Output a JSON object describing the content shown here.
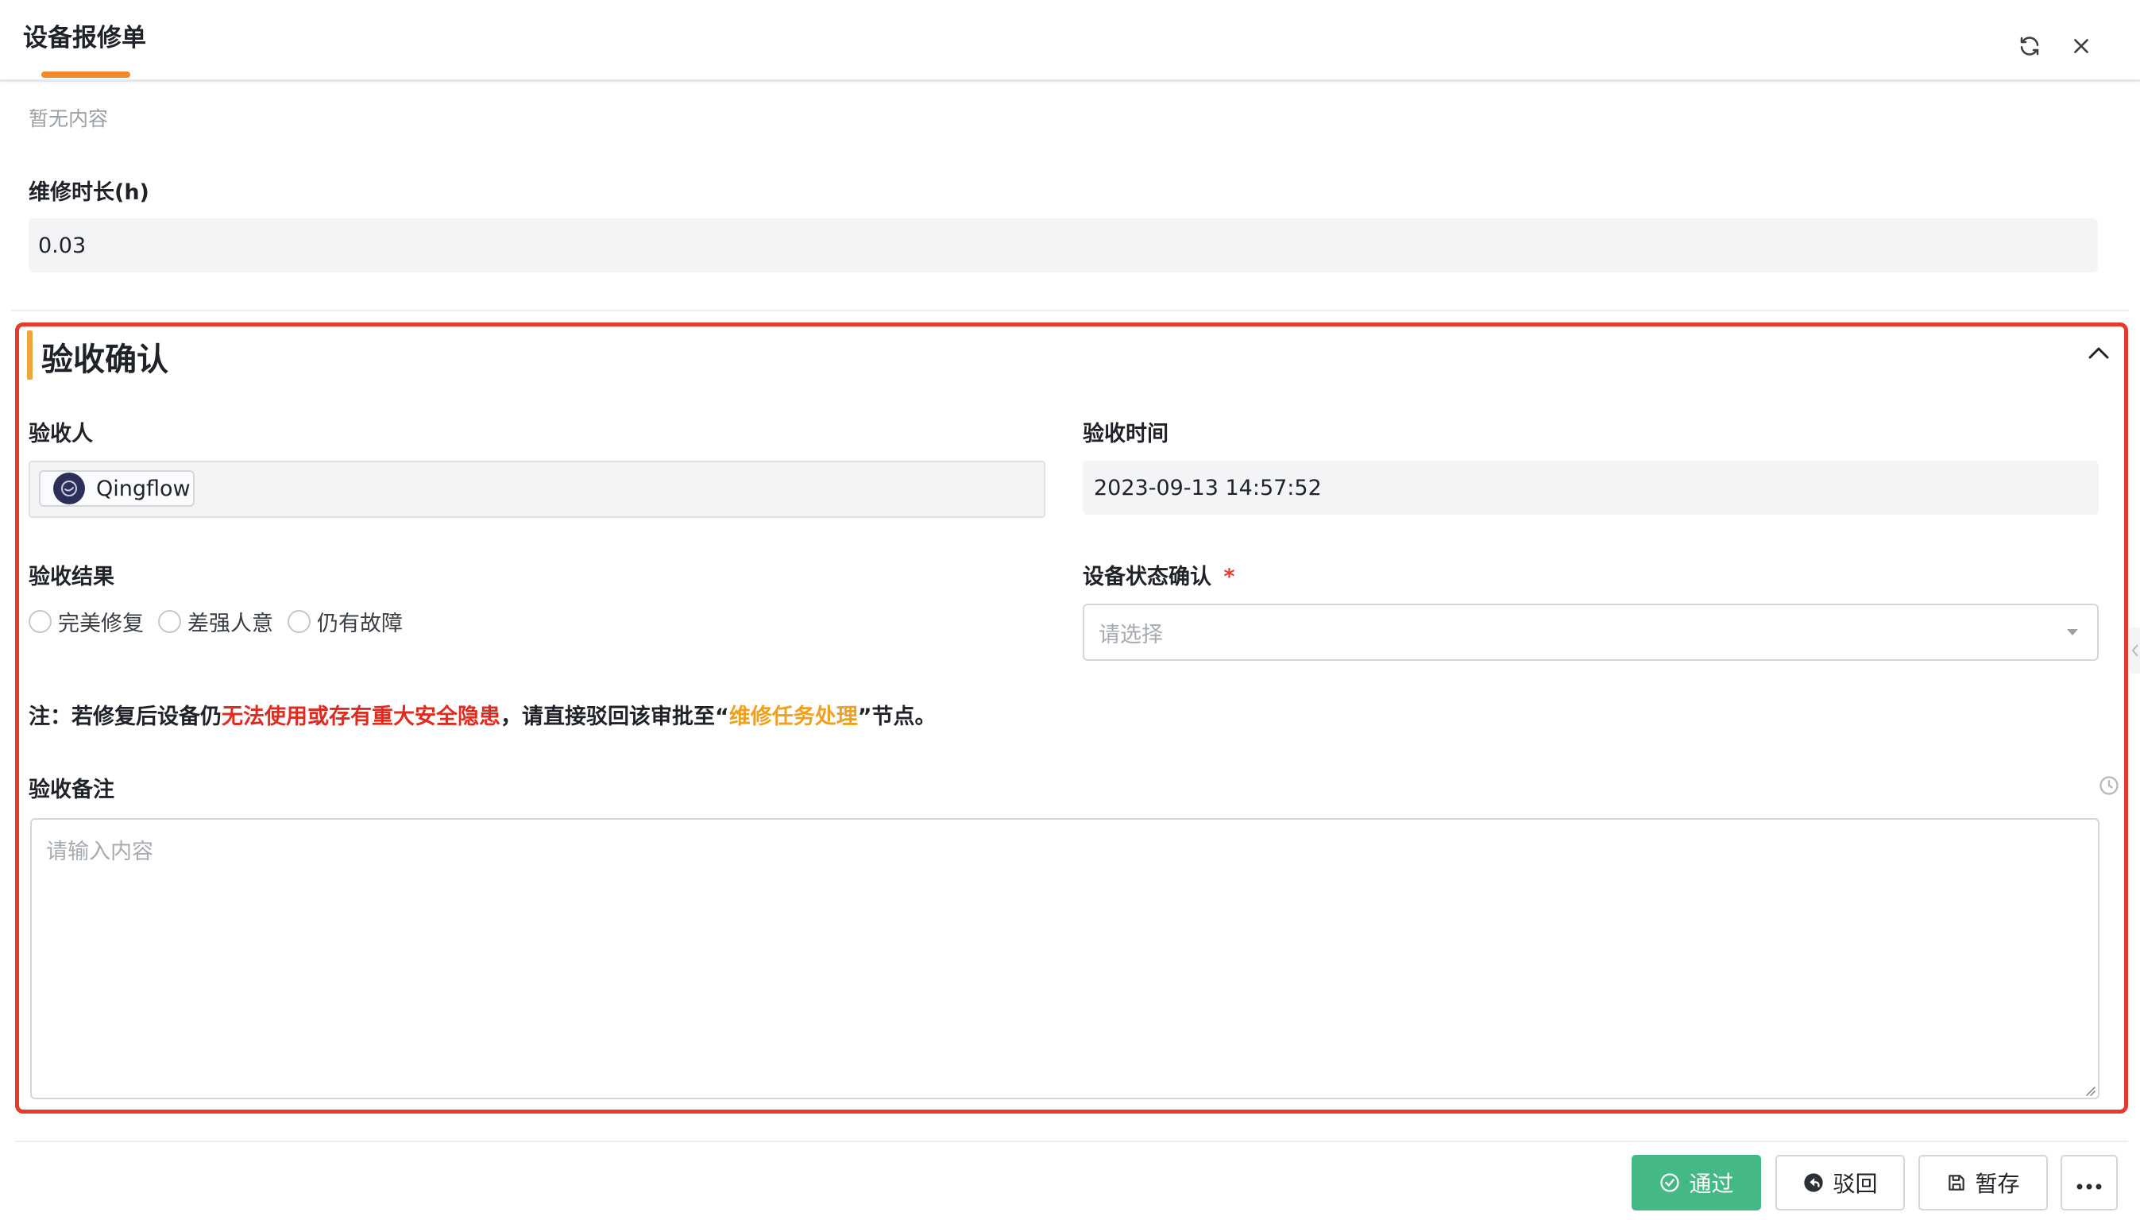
{
  "header": {
    "title": "设备报修单"
  },
  "previous_field": {
    "empty_text": "暂无内容"
  },
  "repair_duration": {
    "label": "维修时长(h)",
    "value": "0.03"
  },
  "section": {
    "title": "验收确认",
    "inspector": {
      "label": "验收人",
      "member_name": "Qingflow"
    },
    "inspection_time": {
      "label": "验收时间",
      "value": "2023-09-13 14:57:52"
    },
    "inspection_result": {
      "label": "验收结果",
      "options": [
        "完美修复",
        "差强人意",
        "仍有故障"
      ]
    },
    "device_status": {
      "label": "设备状态确认",
      "required_mark": "*",
      "placeholder": "请选择"
    },
    "note": {
      "prefix": "注：若修复后设备仍",
      "highlight_red": "无法使用或存有重大安全隐患",
      "middle": "，请直接驳回该审批至“",
      "highlight_orange": "维修任务处理",
      "suffix": "”节点。"
    },
    "remarks": {
      "label": "验收备注",
      "placeholder": "请输入内容"
    }
  },
  "footer": {
    "pass_label": "通过",
    "reject_label": "驳回",
    "save_label": "暂存"
  },
  "colors": {
    "accent_orange": "#f08a2c",
    "section_border": "#e53b2c",
    "pass_green": "#44b985",
    "note_red": "#e02b20",
    "note_orange": "#f0a020"
  }
}
